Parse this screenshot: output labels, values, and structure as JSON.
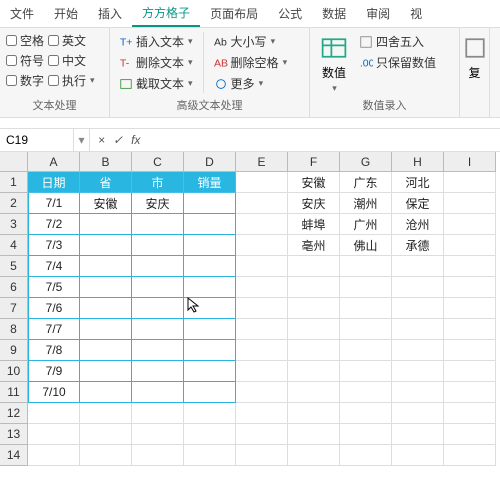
{
  "tabs": [
    "文件",
    "开始",
    "插入",
    "方方格子",
    "页面布局",
    "公式",
    "数据",
    "审阅",
    "视"
  ],
  "activeTab": 3,
  "group1": {
    "checks": [
      [
        "空格",
        "英文"
      ],
      [
        "符号",
        "中文"
      ],
      [
        "数字",
        "执行"
      ]
    ],
    "label": "文本处理"
  },
  "group2": {
    "col1": [
      "插入文本",
      "删除文本",
      "截取文本"
    ],
    "col2": [
      "大小写",
      "删除空格",
      "更多"
    ],
    "label": "高级文本处理"
  },
  "group3": {
    "main": "数值",
    "side": [
      "四舍五入",
      "只保留数值"
    ],
    "label": "数值录入"
  },
  "group4": "复",
  "namebox": "C19",
  "fx": "fx",
  "cols": [
    "A",
    "B",
    "C",
    "D",
    "E",
    "F",
    "G",
    "H",
    "I"
  ],
  "headers": [
    "日期",
    "省",
    "市",
    "销量"
  ],
  "dates": [
    "7/1",
    "7/2",
    "7/3",
    "7/4",
    "7/5",
    "7/6",
    "7/7",
    "7/8",
    "7/9",
    "7/10"
  ],
  "b2": "安徽",
  "c2": "安庆",
  "side": {
    "r1": [
      "安徽",
      "广东",
      "河北"
    ],
    "r2": [
      "安庆",
      "潮州",
      "保定"
    ],
    "r3": [
      "蚌埠",
      "广州",
      "沧州"
    ],
    "r4": [
      "亳州",
      "佛山",
      "承德"
    ]
  },
  "rowCount": 14
}
